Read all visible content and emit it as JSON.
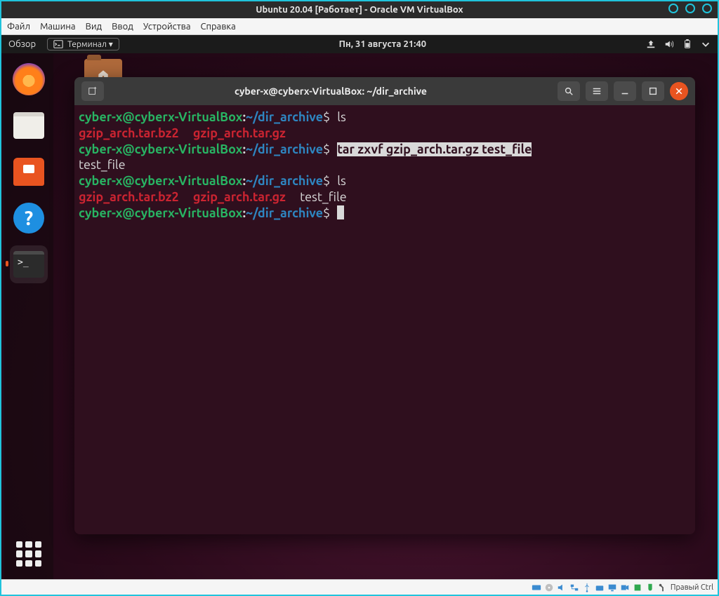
{
  "virtualbox": {
    "title": "Ubuntu 20.04 [Работает] - Oracle VM VirtualBox",
    "menu": [
      "Файл",
      "Машина",
      "Вид",
      "Ввод",
      "Устройства",
      "Справка"
    ],
    "status_host_key": "Правый Ctrl"
  },
  "gnome": {
    "overview": "Обзор",
    "app_indicator": "Терминал ▾",
    "clock": "Пн, 31 августа  21:40"
  },
  "dock": {
    "firefox": "firefox",
    "files": "files",
    "software": "ubuntu-software",
    "help": "help",
    "terminal": "terminal",
    "apps": "show-applications",
    "terminal_glyph": ">_",
    "help_glyph": "?"
  },
  "terminal": {
    "titlebar": "cyber-x@cyberx-VirtualBox: ~/dir_archive",
    "prompt_user": "cyber-x@cyberx-VirtualBox",
    "prompt_sep": ":",
    "prompt_path": "~/dir_archive",
    "prompt_doll": "$",
    "cmd1": "ls",
    "ls1_a": "gzip_arch.tar.bz2",
    "ls1_b": "gzip_arch.tar.gz",
    "cmd2_sel": "tar zxvf gzip_arch.tar.gz test_file",
    "out2": "test_file",
    "cmd3": "ls",
    "ls2_a": "gzip_arch.tar.bz2",
    "ls2_b": "gzip_arch.tar.gz",
    "ls2_c": "test_file"
  }
}
